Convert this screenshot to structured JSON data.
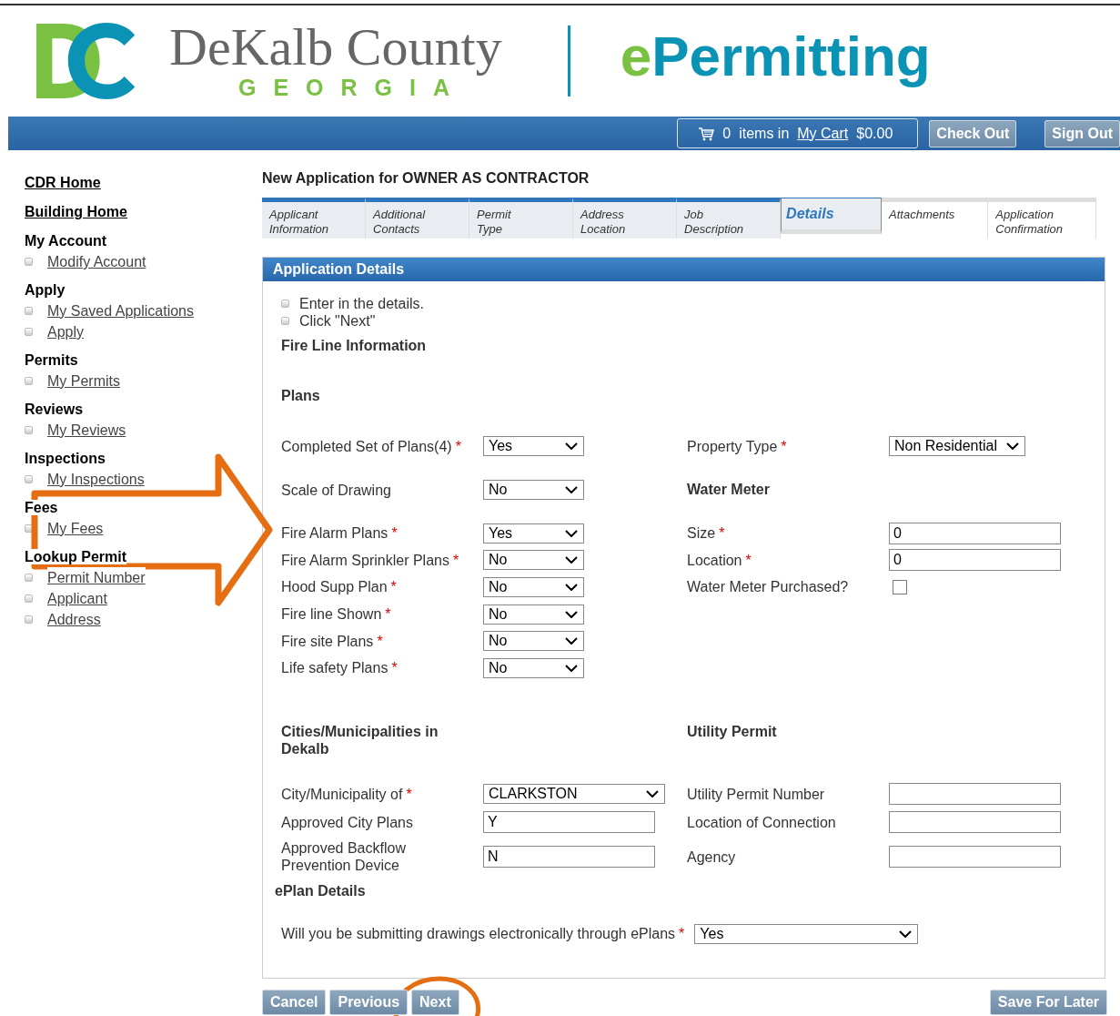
{
  "header": {
    "county": "DeKalb County",
    "state": "GEORGIA",
    "product_prefix": "e",
    "product_rest": "Permitting"
  },
  "top_bar": {
    "cart_count": "0",
    "cart_text": "items in",
    "cart_link": "My Cart",
    "cart_total": "$0.00",
    "buttons": [
      "Check Out",
      "Sign Out"
    ]
  },
  "sidebar": [
    {
      "kind": "link",
      "label": "CDR Home"
    },
    {
      "kind": "link",
      "label": "Building Home"
    },
    {
      "kind": "group",
      "label": "My Account",
      "items": [
        "Modify Account"
      ]
    },
    {
      "kind": "group",
      "label": "Apply",
      "items": [
        "My Saved Applications",
        "Apply"
      ]
    },
    {
      "kind": "group",
      "label": "Permits",
      "items": [
        "My Permits"
      ]
    },
    {
      "kind": "group",
      "label": "Reviews",
      "items": [
        "My Reviews"
      ]
    },
    {
      "kind": "group",
      "label": "Inspections",
      "items": [
        "My Inspections"
      ]
    },
    {
      "kind": "group",
      "label": "Fees",
      "items": [
        "My Fees"
      ]
    },
    {
      "kind": "group",
      "label": "Lookup Permit",
      "items": [
        "Permit Number",
        "Applicant",
        "Address"
      ]
    }
  ],
  "page_title": "New Application for OWNER AS CONTRACTOR",
  "tabs": [
    {
      "label": "Applicant Information",
      "selected": false,
      "visited": true
    },
    {
      "label": "Additional Contacts",
      "selected": false,
      "visited": true
    },
    {
      "label": "Permit Type",
      "selected": false,
      "visited": true
    },
    {
      "label": "Address Location",
      "selected": false,
      "visited": true
    },
    {
      "label": "Job Description",
      "selected": false,
      "visited": true
    },
    {
      "label": "Details",
      "selected": true,
      "visited": true
    },
    {
      "label": "Attachments",
      "selected": false,
      "visited": false
    },
    {
      "label": "Application Confirmation",
      "selected": false,
      "visited": false
    }
  ],
  "panel_title": "Application Details",
  "instructions": [
    "Enter in the details.",
    "Click \"Next\""
  ],
  "section_title": "Fire Line Information",
  "plans_heading": "Plans",
  "rows": [
    [
      {
        "kind": "select",
        "label": "Completed Set of Plans(4)",
        "required_mark": "*",
        "value": "Yes"
      },
      {
        "kind": "select",
        "label": "Property Type",
        "required_mark": "*",
        "value": "Non Residential"
      }
    ],
    [
      {
        "kind": "select",
        "label": "Scale of Drawing",
        "value": "No"
      },
      {
        "kind": "heading",
        "label": "Water Meter"
      }
    ],
    [
      {
        "kind": "select",
        "label": "Fire Alarm Plans",
        "required_mark": "*",
        "value": "Yes"
      },
      {
        "kind": "text",
        "label": "Size",
        "required_mark": "*",
        "value": "0"
      }
    ],
    [
      {
        "kind": "select",
        "label": "Fire Alarm Sprinkler Plans",
        "required_mark": "*",
        "value": "No"
      },
      {
        "kind": "text",
        "label": "Location",
        "required_mark": "*",
        "value": "0"
      }
    ],
    [
      {
        "kind": "select",
        "label": "Hood Supp Plan",
        "required_mark": "*",
        "value": "No"
      },
      {
        "kind": "checkbox",
        "label": "Water Meter Purchased?",
        "checked": false
      }
    ],
    [
      {
        "kind": "select",
        "label": "Fire line Shown",
        "required_mark": "*",
        "value": "No"
      },
      null
    ],
    [
      {
        "kind": "select",
        "label": "Fire site Plans",
        "required_mark": "*",
        "value": "No"
      },
      null
    ],
    [
      {
        "kind": "select",
        "label": "Life safety Plans",
        "required_mark": "*",
        "value": "No"
      },
      null
    ]
  ],
  "rows2": [
    [
      {
        "kind": "heading",
        "label": "Cities/Municipalities in Dekalb"
      },
      {
        "kind": "heading",
        "label": "Utility Permit"
      }
    ],
    [
      {
        "kind": "wideselect",
        "label": "City/Municipality of",
        "required_mark": "*",
        "value": "CLARKSTON"
      },
      {
        "kind": "text",
        "label": "Utility Permit Number"
      }
    ],
    [
      {
        "kind": "text",
        "label": "Approved City Plans",
        "value": "Y"
      },
      {
        "kind": "text",
        "label": "Location of Connection"
      }
    ],
    [
      {
        "kind": "text",
        "label": "Approved Backflow Prevention Device",
        "value": "N"
      },
      {
        "kind": "text",
        "label": "Agency"
      }
    ]
  ],
  "eplan": {
    "heading": "ePlan Details",
    "label": "Will you be submitting drawings electronically through ePlans",
    "required_mark": "*",
    "value": "Yes"
  },
  "buttons": [
    "Cancel",
    "Previous",
    "Next"
  ],
  "save_button": "Save For Later"
}
